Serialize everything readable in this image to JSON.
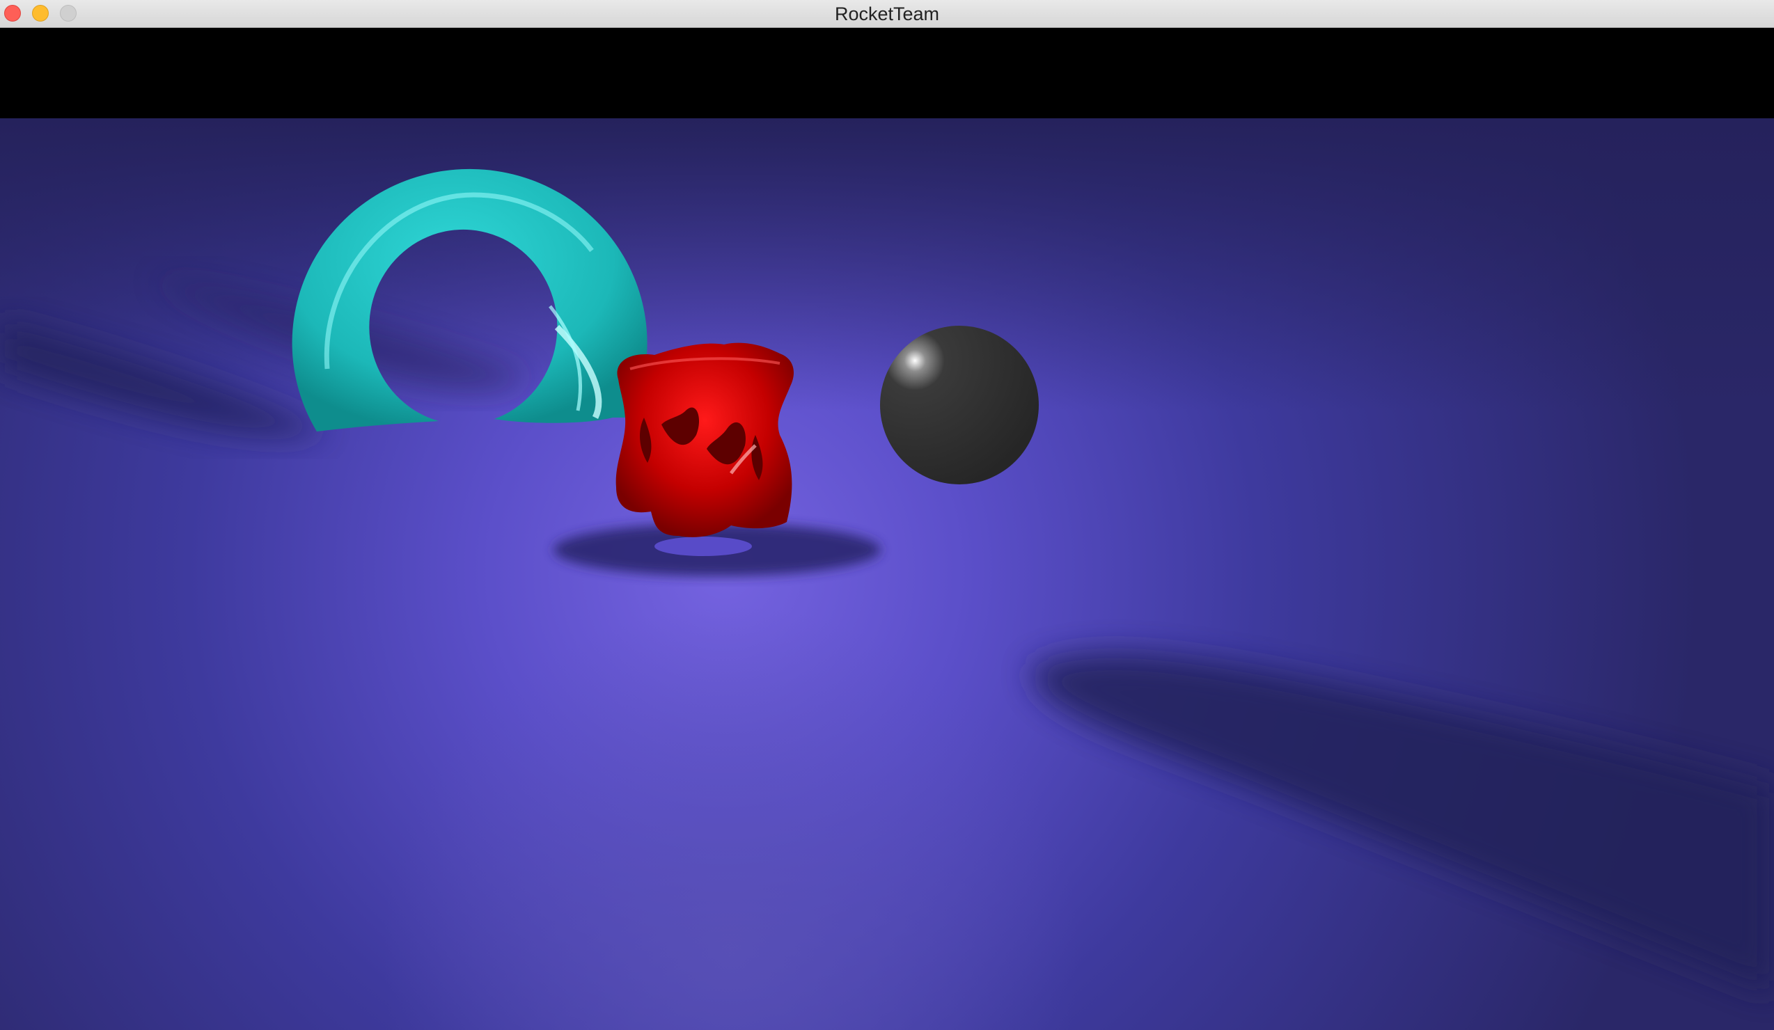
{
  "window": {
    "title": "RocketTeam",
    "controls": {
      "close": "close-icon",
      "minimize": "minimize-icon",
      "maximize": "maximize-icon"
    }
  },
  "scene": {
    "floor_color": "#3b3b9a",
    "objects": [
      {
        "name": "torus",
        "color": "#1fbcbc"
      },
      {
        "name": "red-knot",
        "color": "#c00000"
      },
      {
        "name": "sphere",
        "color": "#2e2e2e"
      }
    ]
  }
}
